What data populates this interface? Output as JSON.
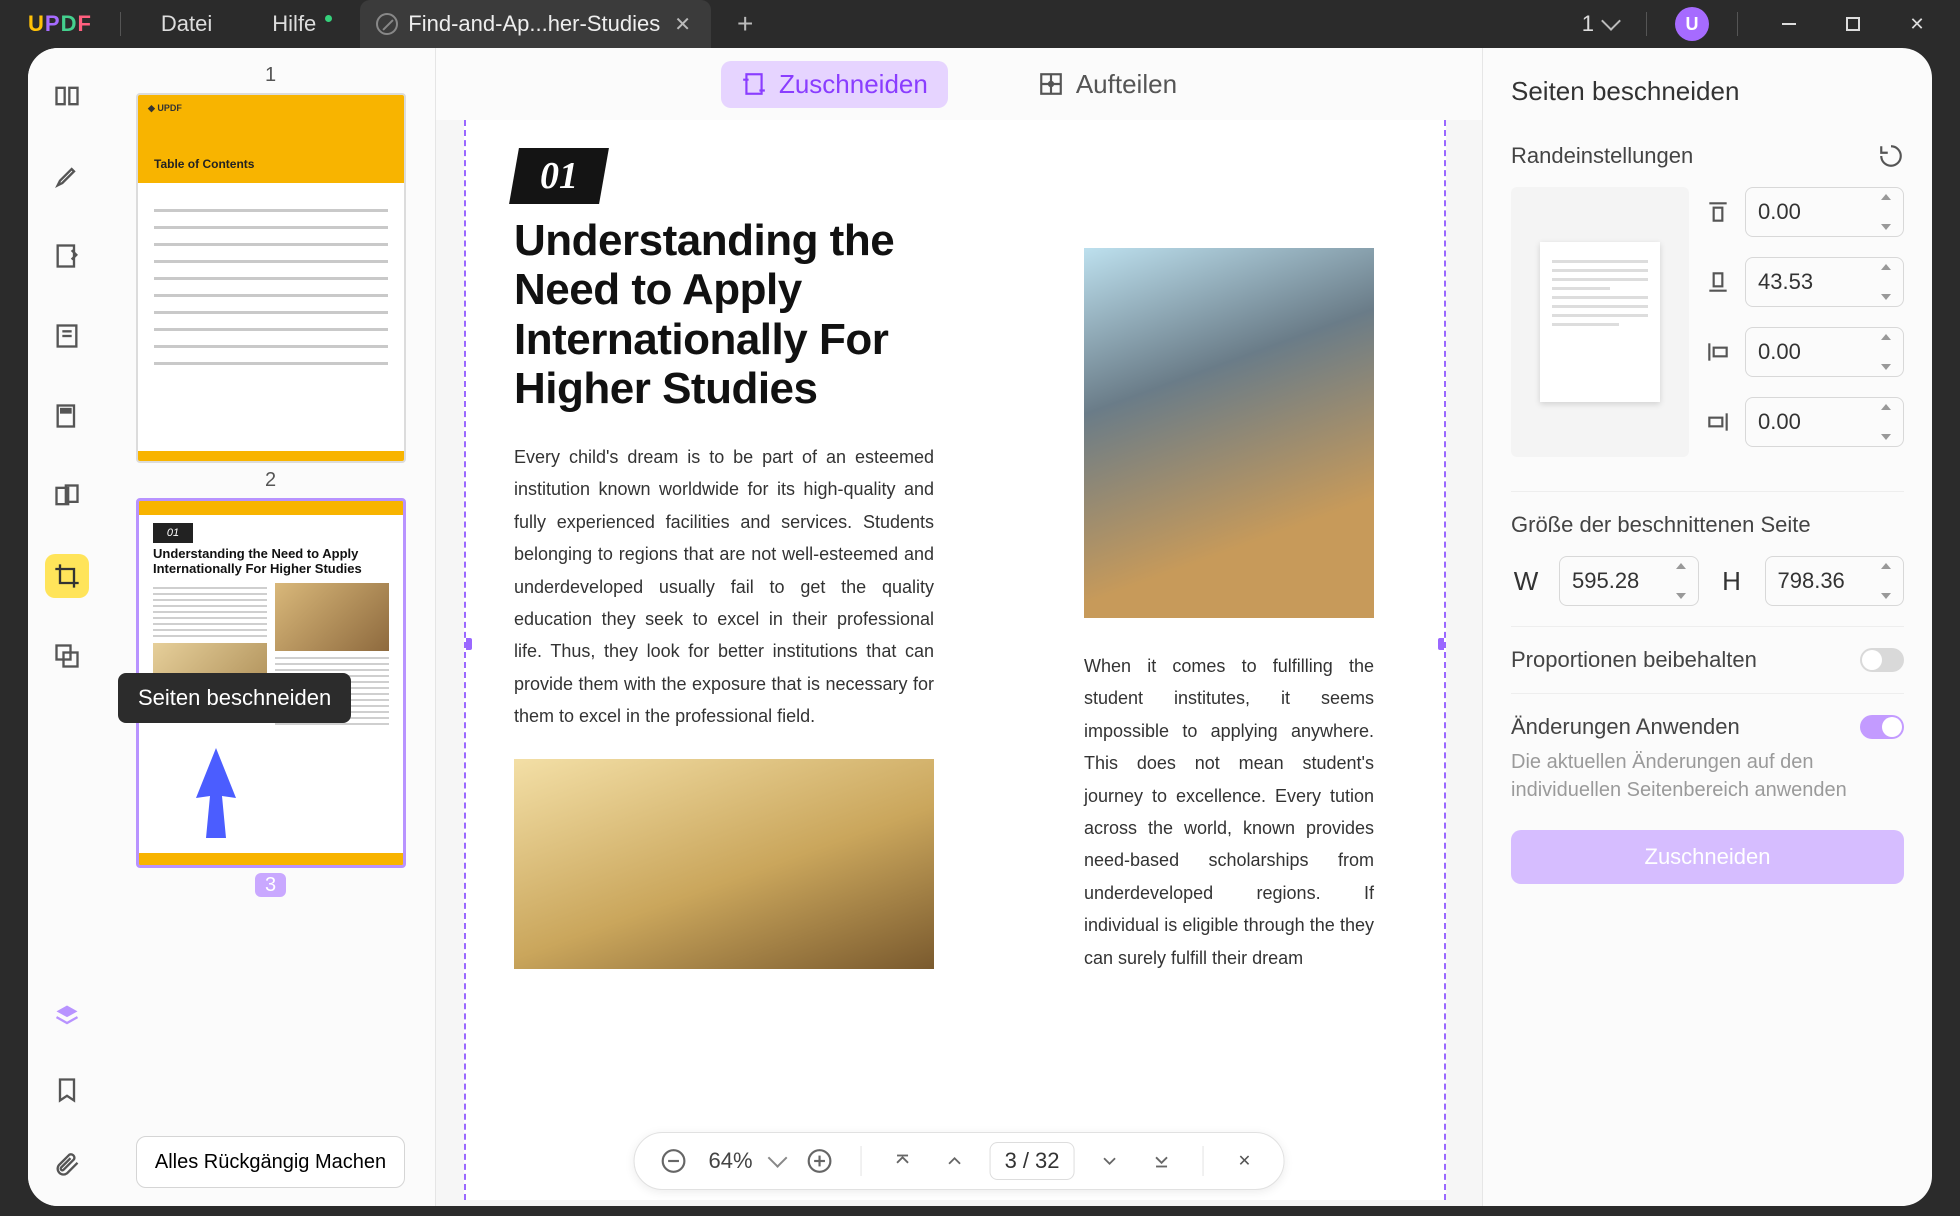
{
  "title": {
    "file_menu": "Datei",
    "help_menu": "Hilfe",
    "tab_name": "Find-and-Ap...her-Studies",
    "page_dropdown": "1",
    "avatar_initial": "U"
  },
  "tooltip": "Seiten beschneiden",
  "thumbs": {
    "n1": "1",
    "n2": "2",
    "n3": "3",
    "undo_all": "Alles Rückgängig Machen",
    "t1_toc": "Table of Contents",
    "t2_chapter": "01",
    "t2_title": "Understanding the Need to Apply Internationally For Higher Studies"
  },
  "modes": {
    "crop": "Zuschneiden",
    "split": "Aufteilen"
  },
  "doc": {
    "chapter": "01",
    "heading": "Understanding the Need to Apply Internationally For Higher Studies",
    "para1": "Every child's dream is to be part of an esteemed institution known worldwide for its high-quality and fully experienced facilities and services. Students belonging to regions that are not well-esteemed and underdeveloped usually fail to get the quality education they seek to excel in their professional life. Thus, they look for better institutions that can provide them with the exposure that is necessary for them to excel in the professional field.",
    "para2": "When it comes to fulfilling the student institutes, it seems impossible to applying anywhere. This does not mean student's journey to excellence. Every tution across the world, known provides need-based scholarships from underdeveloped regions. If individual is eligible through the they can surely fulfill their dream"
  },
  "viewbar": {
    "zoom": "64%",
    "page_cur": "3",
    "page_sep": "/",
    "page_total": "32"
  },
  "panel": {
    "title": "Seiten beschneiden",
    "margins_label": "Randeinstellungen",
    "top": "0.00",
    "bottom": "43.53",
    "left": "0.00",
    "right": "0.00",
    "size_label": "Größe der beschnittenen Seite",
    "w_label": "W",
    "w": "595.28",
    "h_label": "H",
    "h": "798.36",
    "keep_prop": "Proportionen beibehalten",
    "apply_changes": "Änderungen Anwenden",
    "apply_hint": "Die aktuellen Änderungen auf den individuellen Seitenbereich anwenden",
    "crop_button": "Zuschneiden"
  }
}
